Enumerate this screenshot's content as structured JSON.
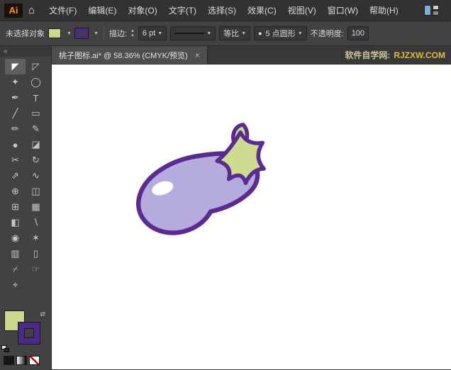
{
  "app": {
    "logo_text": "Ai",
    "home_glyph": "⌂"
  },
  "menubar": {
    "items": [
      {
        "label": "文件(F)"
      },
      {
        "label": "编辑(E)"
      },
      {
        "label": "对象(O)"
      },
      {
        "label": "文字(T)"
      },
      {
        "label": "选择(S)"
      },
      {
        "label": "效果(C)"
      },
      {
        "label": "视图(V)"
      },
      {
        "label": "窗口(W)"
      },
      {
        "label": "帮助(H)"
      }
    ]
  },
  "controlbar": {
    "selection_status": "未选择对象",
    "fill_swatch_color": "#ccd88d",
    "stroke_swatch_color": "#4b2a85",
    "stroke_label": "描边:",
    "stepper_up": "▲",
    "stepper_down": "▼",
    "stroke_weight": "6 pt",
    "dropdown_arrow": "▼",
    "profile_label": "等比",
    "brush_bullet": "●",
    "brush_label": "5 点圆形",
    "opacity_label": "不透明度:",
    "opacity_value": "100"
  },
  "tabbar": {
    "doc_title": "桃子图标.ai* @ 58.36% (CMYK/预览)",
    "close_glyph": "×",
    "watermark_site": "软件自学网:",
    "watermark_url": "RJZXW.COM"
  },
  "toolbar": {
    "collapse_glyph": "«",
    "tools": [
      {
        "name": "selection-tool",
        "glyph": "◤"
      },
      {
        "name": "direct-selection-tool",
        "glyph": "◸"
      },
      {
        "name": "magic-wand-tool",
        "glyph": "✦"
      },
      {
        "name": "lasso-tool",
        "glyph": "◯"
      },
      {
        "name": "pen-tool",
        "glyph": "✒"
      },
      {
        "name": "type-tool",
        "glyph": "T"
      },
      {
        "name": "line-segment-tool",
        "glyph": "╱"
      },
      {
        "name": "rectangle-tool",
        "glyph": "▭"
      },
      {
        "name": "paintbrush-tool",
        "glyph": "✏"
      },
      {
        "name": "pencil-tool",
        "glyph": "✎"
      },
      {
        "name": "blob-brush-tool",
        "glyph": "●"
      },
      {
        "name": "eraser-tool",
        "glyph": "◪"
      },
      {
        "name": "scissors-tool",
        "glyph": "✂"
      },
      {
        "name": "rotate-tool",
        "glyph": "↻"
      },
      {
        "name": "scale-tool",
        "glyph": "⇗"
      },
      {
        "name": "width-tool",
        "glyph": "∿"
      },
      {
        "name": "free-transform-tool",
        "glyph": "⊕"
      },
      {
        "name": "shape-builder-tool",
        "glyph": "◫"
      },
      {
        "name": "perspective-grid-tool",
        "glyph": "⊞"
      },
      {
        "name": "mesh-tool",
        "glyph": "▦"
      },
      {
        "name": "gradient-tool",
        "glyph": "◧"
      },
      {
        "name": "eyedropper-tool",
        "glyph": "∖"
      },
      {
        "name": "blend-tool",
        "glyph": "◉"
      },
      {
        "name": "symbol-sprayer-tool",
        "glyph": "✶"
      },
      {
        "name": "column-graph-tool",
        "glyph": "▥"
      },
      {
        "name": "artboard-tool",
        "glyph": "▯"
      },
      {
        "name": "slice-tool",
        "glyph": "⌿"
      },
      {
        "name": "hand-tool",
        "glyph": "☞"
      },
      {
        "name": "zoom-tool",
        "glyph": "⌖"
      }
    ]
  },
  "swatches": {
    "fill_color": "#ccd88d",
    "stroke_color": "#4b2a85",
    "swap_glyph": "⇄"
  },
  "canvas": {
    "eggplant": {
      "body_fill": "#b5abdc",
      "calyx_fill": "#cedc90",
      "outline_color": "#5a2c90",
      "highlight_color": "#ffffff"
    }
  }
}
